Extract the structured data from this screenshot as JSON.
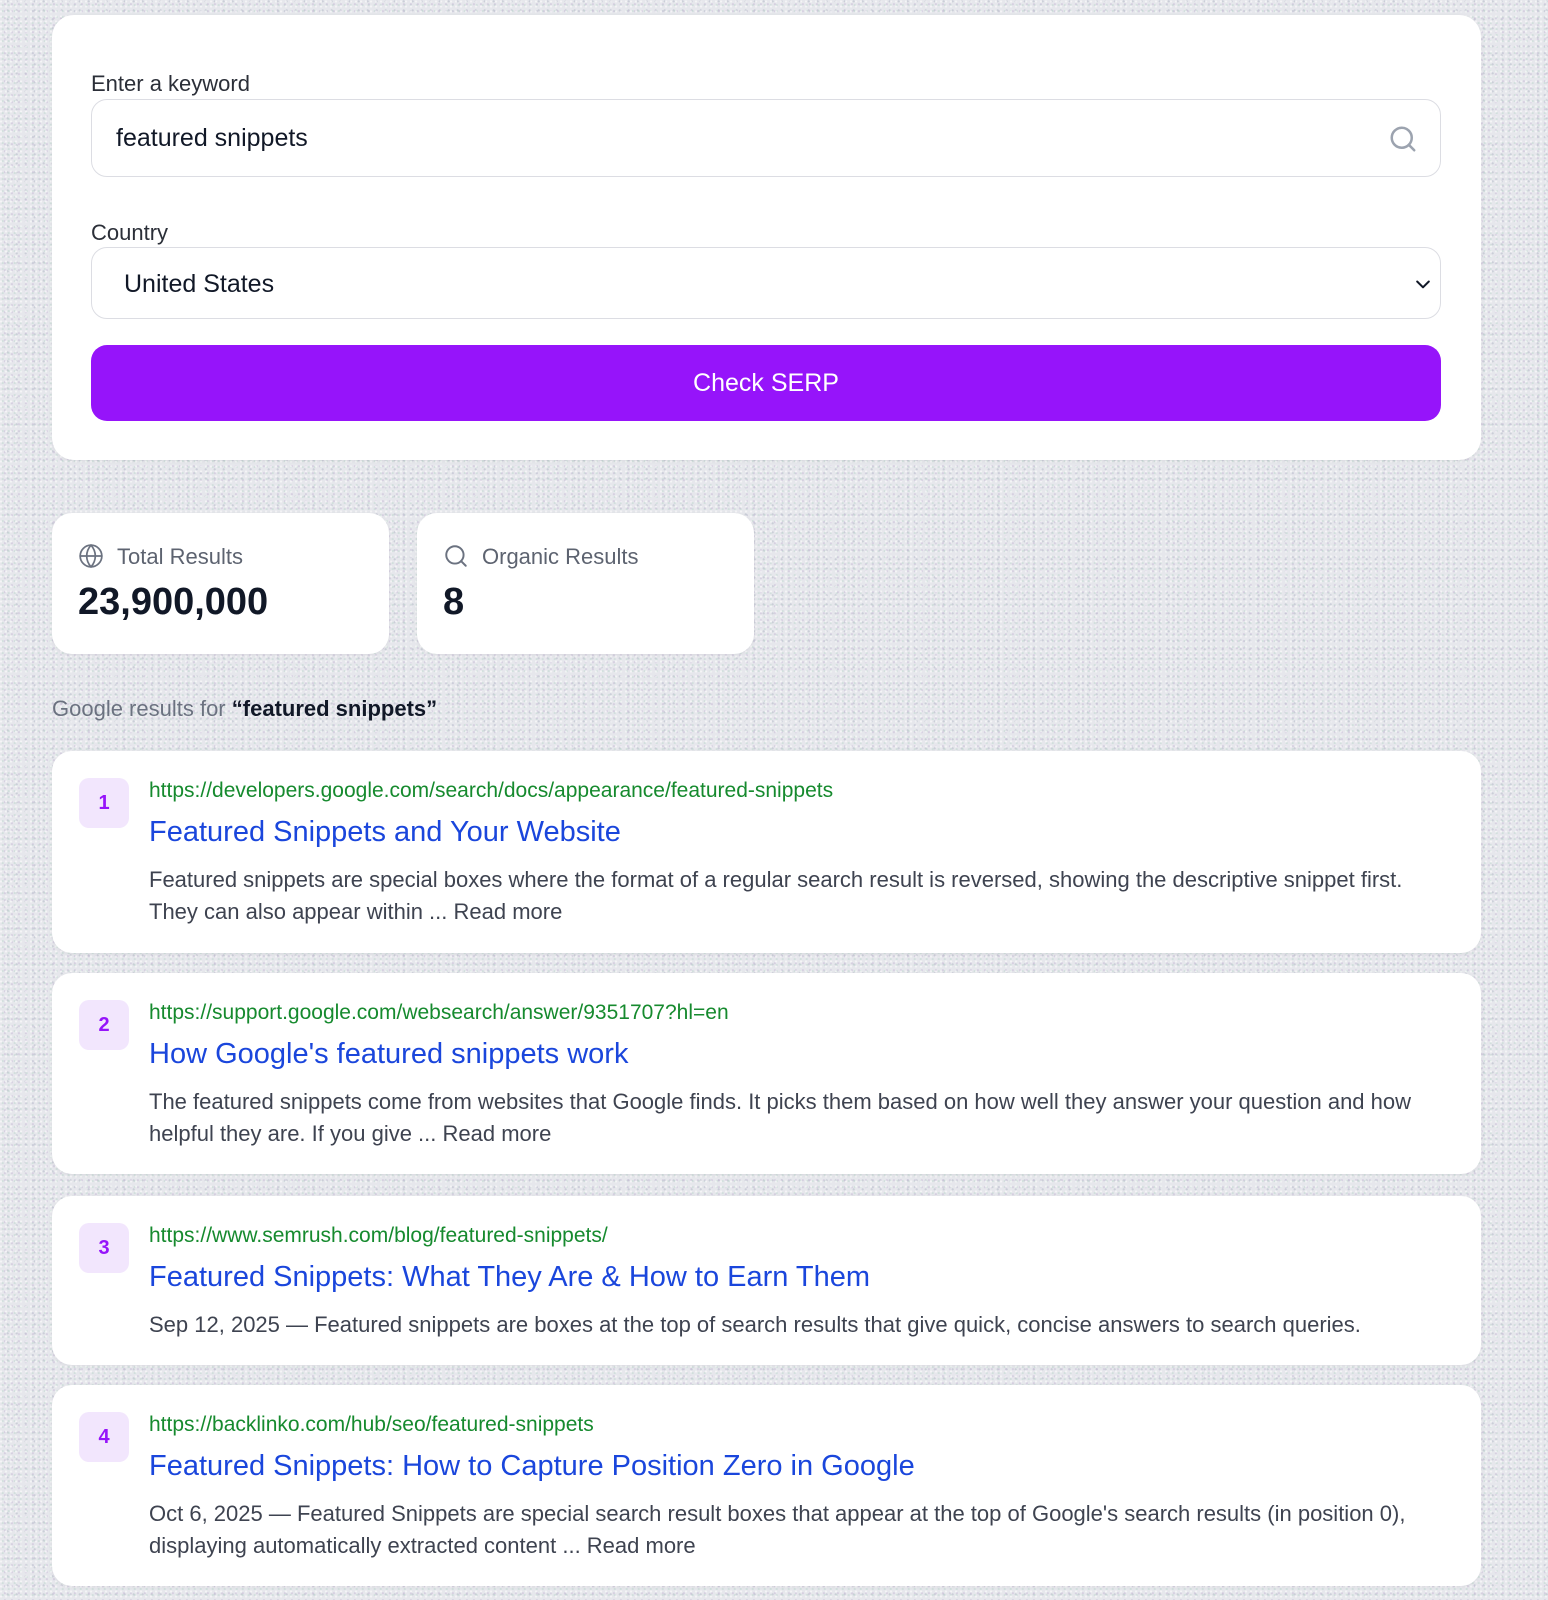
{
  "form": {
    "keyword_label": "Enter a keyword",
    "keyword_value": "featured snippets",
    "country_label": "Country",
    "country_value": "United States",
    "submit_label": "Check SERP"
  },
  "stats": {
    "total_label": "Total Results",
    "total_value": "23,900,000",
    "organic_label": "Organic Results",
    "organic_value": "8"
  },
  "results_heading": {
    "prefix": "Google results for",
    "query": "“featured snippets”"
  },
  "results": [
    {
      "rank": "1",
      "url": "https://developers.google.com/search/docs/appearance/featured-snippets",
      "title": "Featured Snippets and Your Website",
      "snippet": "Featured snippets are special boxes where the format of a regular search result is reversed, showing the descriptive snippet first. They can also appear within ... Read more"
    },
    {
      "rank": "2",
      "url": "https://support.google.com/websearch/answer/9351707?hl=en",
      "title": "How Google's featured snippets work",
      "snippet": "The featured snippets come from websites that Google finds. It picks them based on how well they answer your question and how helpful they are. If you give ... Read more"
    },
    {
      "rank": "3",
      "url": "https://www.semrush.com/blog/featured-snippets/",
      "title": "Featured Snippets: What They Are & How to Earn Them",
      "snippet": "Sep 12, 2025 — Featured snippets are boxes at the top of search results that give quick, concise answers to search queries."
    },
    {
      "rank": "4",
      "url": "https://backlinko.com/hub/seo/featured-snippets",
      "title": "Featured Snippets: How to Capture Position Zero in Google",
      "snippet": "Oct 6, 2025 — Featured Snippets are special search result boxes that appear at the top of Google's search results (in position 0), displaying automatically extracted content ... Read more"
    }
  ],
  "icons": {
    "search": "search-icon",
    "country_dropdown": "chevron-down-icon",
    "total_results": "globe-icon",
    "organic_results": "search-icon"
  },
  "colors": {
    "accent": "#9614fa",
    "url_green": "#168a2e",
    "title_blue": "#1a46dc",
    "badge_bg": "#f2e6fd"
  }
}
